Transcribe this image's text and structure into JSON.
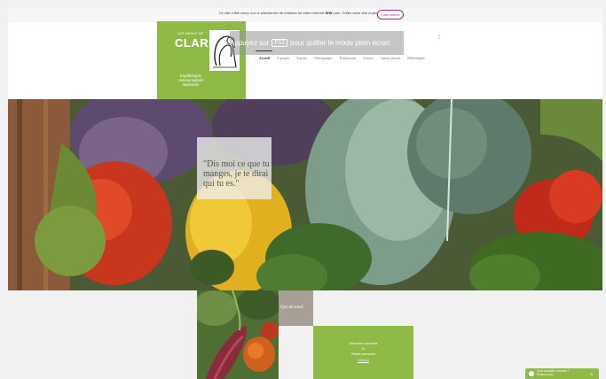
{
  "wix_banner": {
    "text_before": "Ce site a été conçu sur la plateforme de création de sites Internet ",
    "brand": "WIX",
    "text_after": ".com. Créez votre site aujourd'hui.",
    "button_label": "Commencer"
  },
  "logo": {
    "small_title": "LES MENUS DE",
    "name": "CLARA",
    "tagline": "Ergothérapie communautaire autonome"
  },
  "fullscreen_hint": {
    "before": "Appuyez sur",
    "key": "F11",
    "after": "pour quitter le mode plein écran"
  },
  "menu_icon": "⋮",
  "nav": {
    "items": [
      {
        "label": "Accueil",
        "active": true
      },
      {
        "label": "À propos",
        "active": false
      },
      {
        "label": "Articles",
        "active": false
      },
      {
        "label": "Témoignages",
        "active": false
      },
      {
        "label": "Événements",
        "active": false
      },
      {
        "label": "Contact",
        "active": false
      },
      {
        "label": "Galerie photos",
        "active": false
      },
      {
        "label": "Bibliothèque",
        "active": false
      }
    ]
  },
  "hero": {
    "quote": "\"Dis moi ce que tu manges, je te dirai qui tu es.\""
  },
  "qui_sommes": {
    "label": "Qui de neuf"
  },
  "green_panel": {
    "line1": "Décodeur nouvelles",
    "line2": "et",
    "line3": "Petites annonces",
    "link": "C'est ici"
  },
  "chat": {
    "line1": "Vous souhaitez discuter ?",
    "line2": "Écrivez-nous",
    "close": "✕"
  },
  "colors": {
    "brand_green": "#8fba45",
    "wix_purple": "#9b2c8e",
    "taupe": "#a89f96"
  }
}
